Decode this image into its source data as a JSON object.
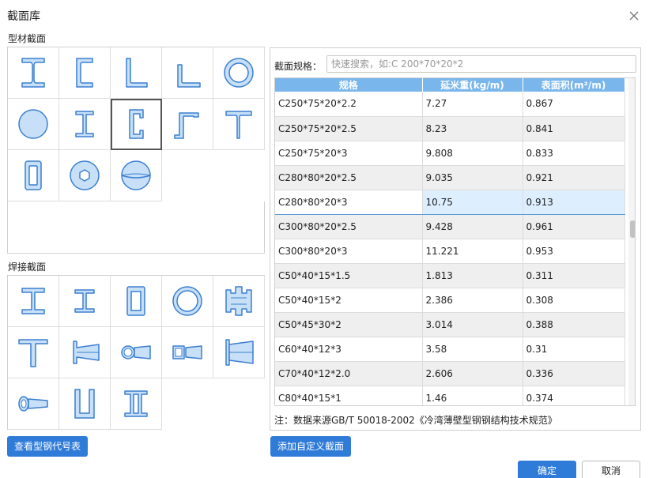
{
  "dialog": {
    "title": "截面库",
    "section_profile_label": "型材截面",
    "section_weld_label": "焊接截面",
    "btn_view_codes": "查看型钢代号表",
    "btn_add_custom": "添加自定义截面",
    "btn_ok": "确定",
    "btn_cancel": "取消"
  },
  "profile_icons": [
    "i-beam-icon",
    "channel-icon",
    "angle-icon",
    "unequal-angle-icon",
    "pipe-icon",
    "round-bar-icon",
    "h-beam-icon",
    "c-channel-icon",
    "z-section-icon",
    "t-section-icon",
    "rect-tube-icon",
    "hex-nut-icon",
    "sphere-icon"
  ],
  "weld_icons": [
    "welded-i-icon",
    "welded-h-icon",
    "welded-box-icon",
    "welded-pipe-icon",
    "welded-cross-icon",
    "welded-t-icon",
    "tapered-i-icon",
    "tapered-pipe-icon",
    "tapered-box-icon",
    "tapered-i-large-icon",
    "tapered-pipe-small-icon",
    "welded-u-icon",
    "welded-double-i-icon"
  ],
  "search": {
    "label": "截面规格：",
    "placeholder": "快速搜索，如:C 200*70*20*2"
  },
  "table": {
    "headers": [
      "规格",
      "延米重(kg/m)",
      "表面积(m²/m)"
    ],
    "rows": [
      [
        "C250*75*20*2.2",
        "7.27",
        "0.867"
      ],
      [
        "C250*75*20*2.5",
        "8.23",
        "0.841"
      ],
      [
        "C250*75*20*3",
        "9.808",
        "0.833"
      ],
      [
        "C280*80*20*2.5",
        "9.035",
        "0.921"
      ],
      [
        "C280*80*20*3",
        "10.75",
        "0.913"
      ],
      [
        "C300*80*20*2.5",
        "9.428",
        "0.961"
      ],
      [
        "C300*80*20*3",
        "11.221",
        "0.953"
      ],
      [
        "C50*40*15*1.5",
        "1.813",
        "0.311"
      ],
      [
        "C50*40*15*2",
        "2.386",
        "0.308"
      ],
      [
        "C50*45*30*2",
        "3.014",
        "0.388"
      ],
      [
        "C60*40*12*3",
        "3.58",
        "0.31"
      ],
      [
        "C70*40*12*2.0",
        "2.606",
        "0.336"
      ],
      [
        "C80*40*15*1",
        "1.46",
        "0.374"
      ]
    ],
    "selected_row": 4
  },
  "note": "注：数据来源GB/T 50018-2002《冷湾薄壁型钢钢结构技术规范》",
  "colors": {
    "accent": "#2f7bd8",
    "header": "#79b6ec",
    "icon_fill": "#c7e0f7",
    "icon_stroke": "#3b7fd0"
  }
}
